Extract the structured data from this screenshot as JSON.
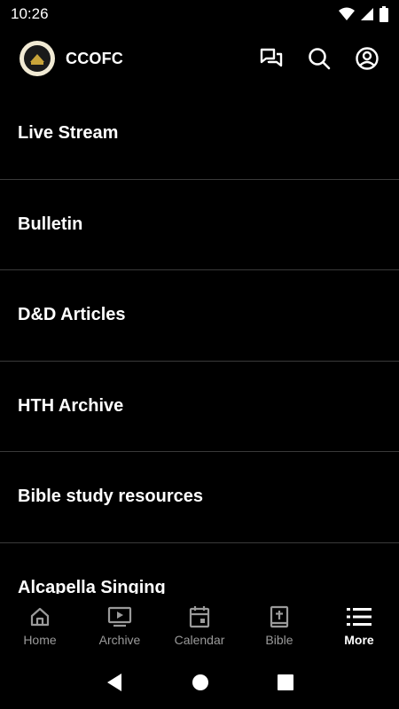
{
  "status_bar": {
    "time": "10:26"
  },
  "app_bar": {
    "title": "CCOFC",
    "logo_icon": "church-seal-logo",
    "actions": [
      {
        "icon": "chat-bubbles-icon"
      },
      {
        "icon": "search-icon"
      },
      {
        "icon": "account-circle-icon"
      }
    ]
  },
  "menu": {
    "items": [
      {
        "label": "Live Stream"
      },
      {
        "label": "Bulletin"
      },
      {
        "label": "D&D Articles"
      },
      {
        "label": "HTH Archive"
      },
      {
        "label": "Bible study resources"
      },
      {
        "label": "Alcapella Singing"
      }
    ]
  },
  "bottom_nav": {
    "tabs": [
      {
        "label": "Home",
        "icon": "home-icon",
        "active": false
      },
      {
        "label": "Archive",
        "icon": "video-icon",
        "active": false
      },
      {
        "label": "Calendar",
        "icon": "calendar-icon",
        "active": false
      },
      {
        "label": "Bible",
        "icon": "bible-icon",
        "active": false
      },
      {
        "label": "More",
        "icon": "list-icon",
        "active": true
      }
    ]
  },
  "colors": {
    "background": "#000000",
    "text": "#ffffff",
    "inactive": "#9a9a9a",
    "divider": "#3a3a3a"
  }
}
